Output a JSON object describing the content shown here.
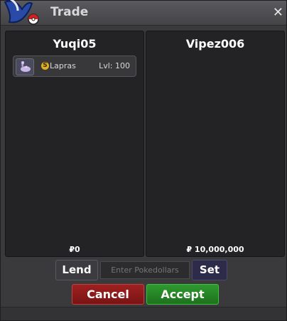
{
  "window": {
    "title": "Trade",
    "close_icon": "✕"
  },
  "left_panel": {
    "player": "Yuqi05",
    "items": [
      {
        "badge": "S",
        "name": "Lapras",
        "level": "Lvl: 100"
      }
    ],
    "money": "₽0"
  },
  "right_panel": {
    "player": "Vipez006",
    "money": "₽ 10,000,000"
  },
  "controls": {
    "lend_label": "Lend",
    "pokedollars_placeholder": "Enter Pokedollars",
    "set_label": "Set",
    "cancel_label": "Cancel",
    "accept_label": "Accept"
  },
  "colors": {
    "cancel": "#8b1a1a",
    "accept": "#278427",
    "set": "#2c2c4a"
  }
}
